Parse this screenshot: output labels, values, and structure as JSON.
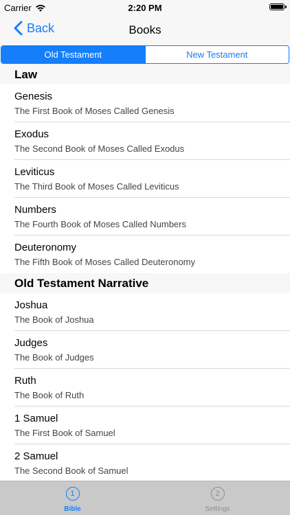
{
  "status_bar": {
    "carrier": "Carrier",
    "time": "2:20 PM"
  },
  "nav": {
    "back_label": "Back",
    "title": "Books"
  },
  "segments": {
    "old": "Old Testament",
    "new": "New Testament",
    "selected": "old"
  },
  "sections": [
    {
      "header": "Law",
      "rows": [
        {
          "title": "Genesis",
          "subtitle": "The First Book of Moses Called Genesis"
        },
        {
          "title": "Exodus",
          "subtitle": "The Second Book of Moses Called Exodus"
        },
        {
          "title": "Leviticus",
          "subtitle": "The Third Book of Moses Called Leviticus"
        },
        {
          "title": "Numbers",
          "subtitle": "The Fourth Book of Moses Called Numbers"
        },
        {
          "title": "Deuteronomy",
          "subtitle": "The Fifth Book of Moses Called Deuteronomy"
        }
      ]
    },
    {
      "header": "Old Testament Narrative",
      "rows": [
        {
          "title": "Joshua",
          "subtitle": "The Book of Joshua"
        },
        {
          "title": "Judges",
          "subtitle": "The Book of Judges"
        },
        {
          "title": "Ruth",
          "subtitle": "The Book of Ruth"
        },
        {
          "title": "1 Samuel",
          "subtitle": "The First Book of Samuel"
        },
        {
          "title": "2 Samuel",
          "subtitle": "The Second Book of Samuel"
        }
      ]
    }
  ],
  "tabs": [
    {
      "number": "1",
      "label": "Bible",
      "active": true
    },
    {
      "number": "2",
      "label": "Settings",
      "active": false
    }
  ],
  "colors": {
    "accent": "#147efb",
    "bar_background": "#f7f7f7",
    "tab_bar_background": "#c9c9c9"
  }
}
